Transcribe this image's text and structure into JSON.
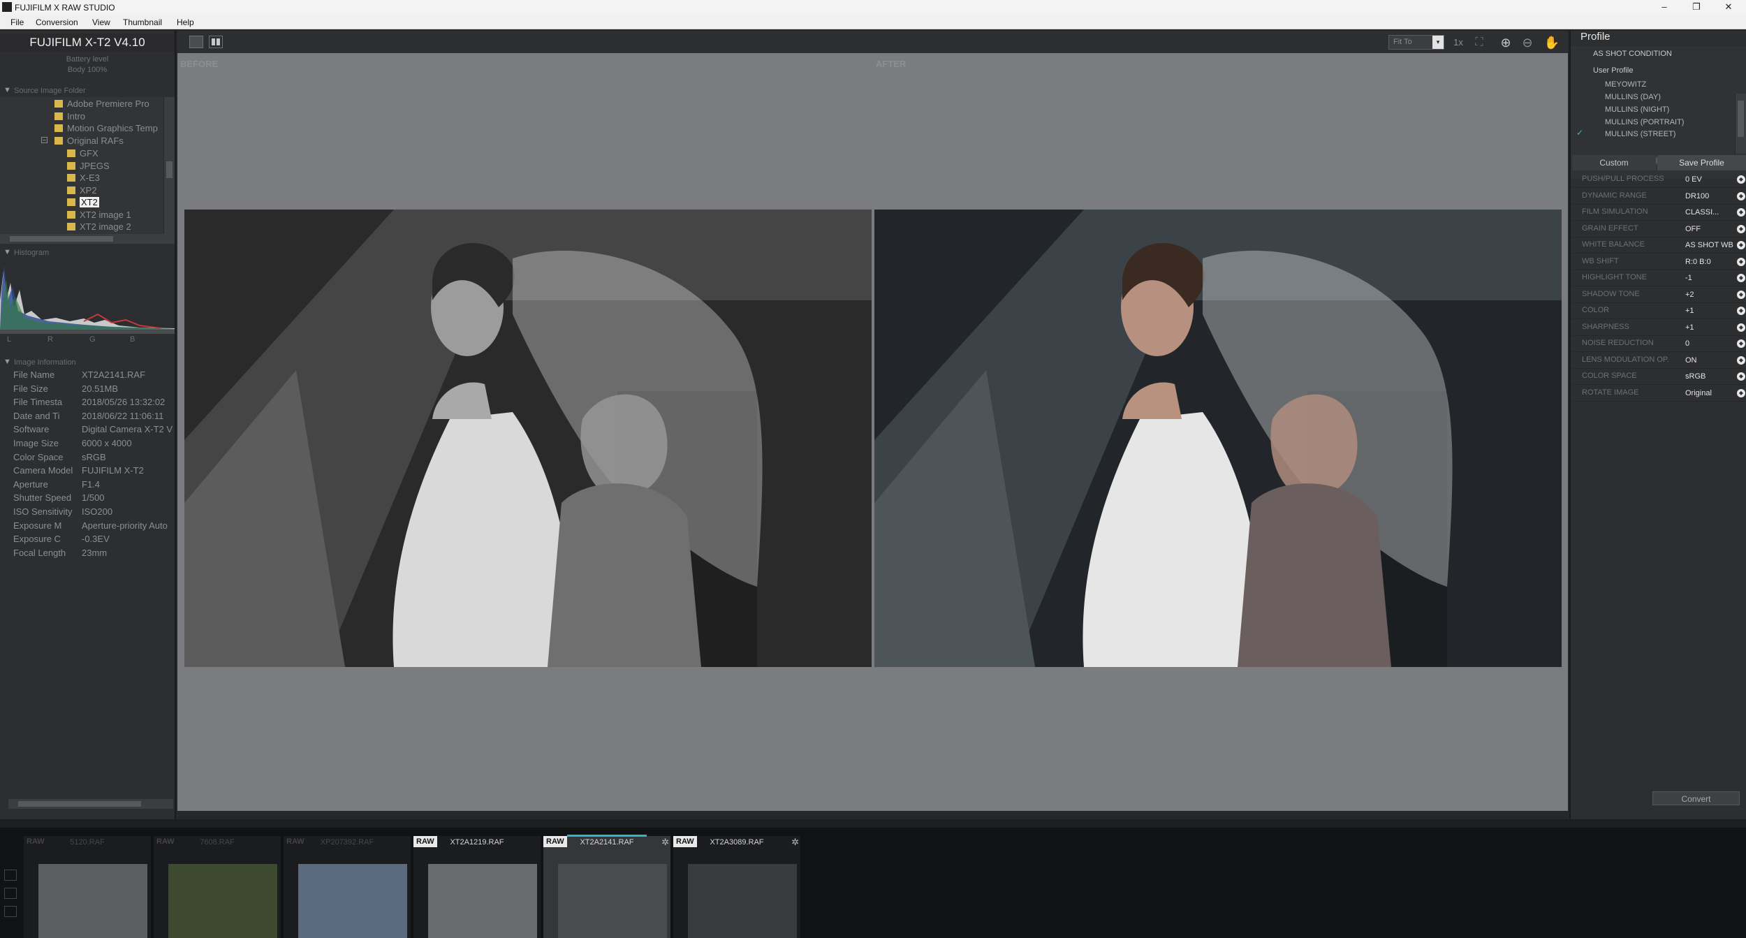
{
  "window": {
    "title": "FUJIFILM X RAW STUDIO",
    "minimize": "–",
    "restore": "❐",
    "close": "✕"
  },
  "menu": [
    "File",
    "Conversion",
    "View",
    "Thumbnail",
    "Help"
  ],
  "camera": {
    "model_label": "FUJIFILM X-T2   V4.10",
    "battery_label": "Battery level",
    "battery_value": "Body 100%"
  },
  "source_folder": {
    "title": "Source Image Folder",
    "items": [
      "Adobe Premiere Pro",
      "Intro",
      "Motion Graphics Temp",
      "Original RAFs",
      "GFX",
      "JPEGS",
      "X-E3",
      "XP2",
      "XT2",
      "XT2 image 1",
      "XT2 image 2"
    ],
    "selected": "XT2"
  },
  "histogram": {
    "title": "Histogram",
    "channels": [
      "L",
      "R",
      "G",
      "B"
    ]
  },
  "image_info": {
    "title": "Image Information",
    "rows": [
      {
        "k": "File Name",
        "v": "XT2A2141.RAF"
      },
      {
        "k": "File Size",
        "v": "20.51MB"
      },
      {
        "k": "File Timesta",
        "v": "2018/05/26 13:32:02"
      },
      {
        "k": "Date and Ti",
        "v": "2018/06/22 11:06:11"
      },
      {
        "k": "Software",
        "v": "Digital Camera X-T2 V"
      },
      {
        "k": "Image Size",
        "v": "6000 x 4000"
      },
      {
        "k": "Color Space",
        "v": "sRGB"
      },
      {
        "k": "Camera Model",
        "v": "FUJIFILM X-T2"
      },
      {
        "k": "Aperture",
        "v": "F1.4"
      },
      {
        "k": "Shutter Speed",
        "v": "1/500"
      },
      {
        "k": "ISO Sensitivity",
        "v": "ISO200"
      },
      {
        "k": "Exposure M",
        "v": "Aperture-priority Auto"
      },
      {
        "k": "Exposure C",
        "v": "-0.3EV"
      },
      {
        "k": "Focal Length",
        "v": "23mm"
      }
    ]
  },
  "toolbar": {
    "fit": "Fit To",
    "arrow": "▾",
    "one_x": "1x",
    "zoom_in": "⊕",
    "zoom_out": "⊖",
    "hand": "✋"
  },
  "viewer": {
    "before": "BEFORE",
    "after": "AFTER"
  },
  "profile": {
    "title": "Profile",
    "as_shot": "AS SHOT CONDITION",
    "user_profile": "User Profile",
    "items": [
      "MEYOWITZ",
      "MULLINS (DAY)",
      "MULLINS (NIGHT)",
      "MULLINS (PORTRAIT)",
      "MULLINS (STREET)"
    ],
    "checked": "✓",
    "custom_tab": "Custom",
    "save_tab": "Save Profile"
  },
  "params": [
    {
      "k": "PUSH/PULL PROCESS",
      "v": "0 EV"
    },
    {
      "k": "DYNAMIC RANGE",
      "v": "DR100"
    },
    {
      "k": "FILM SIMULATION",
      "v": "CLASSI..."
    },
    {
      "k": "GRAIN EFFECT",
      "v": "OFF"
    },
    {
      "k": "WHITE BALANCE",
      "v": "AS SHOT WB"
    },
    {
      "k": "WB SHIFT",
      "v": "R:0 B:0"
    },
    {
      "k": "HIGHLIGHT TONE",
      "v": "-1"
    },
    {
      "k": "SHADOW TONE",
      "v": "+2"
    },
    {
      "k": "COLOR",
      "v": "+1"
    },
    {
      "k": "SHARPNESS",
      "v": "+1"
    },
    {
      "k": "NOISE REDUCTION",
      "v": "0"
    },
    {
      "k": "LENS MODULATION OP.",
      "v": "ON"
    },
    {
      "k": "COLOR SPACE",
      "v": "sRGB"
    },
    {
      "k": "ROTATE IMAGE",
      "v": "Original"
    }
  ],
  "spin_icon": "◆",
  "convert": "Convert",
  "thumbnails": [
    {
      "raw": "RAW",
      "name": "5120.RAF",
      "dim": true,
      "tone": "#5b5d60"
    },
    {
      "raw": "RAW",
      "name": "7608.RAF",
      "dim": true,
      "tone": "#3e4a30"
    },
    {
      "raw": "RAW",
      "name": "XP207392.RAF",
      "dim": true,
      "tone": "#5c6a80"
    },
    {
      "raw": "RAW",
      "name": "XT2A1219.RAF",
      "dim": false,
      "tone": "#6a6b6d"
    },
    {
      "raw": "RAW",
      "name": "XT2A2141.RAF",
      "dim": false,
      "tone": "#4a4b4e"
    },
    {
      "raw": "RAW",
      "name": "XT2A3089.RAF",
      "dim": false,
      "tone": "#3a3b3e"
    }
  ],
  "gear_icon": "✲",
  "colors": {
    "accent": "#2fb7c8",
    "folder": "#d8b84a"
  }
}
